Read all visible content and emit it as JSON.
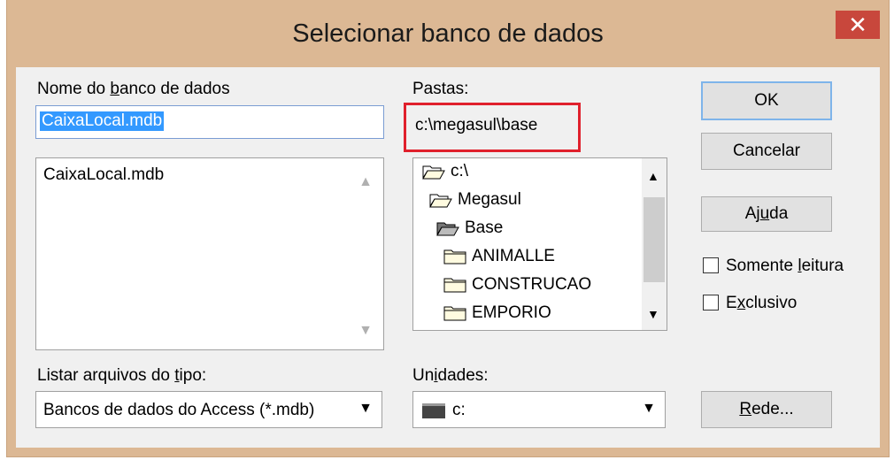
{
  "dialog": {
    "title": "Selecionar banco de dados",
    "close_symbol": "✕"
  },
  "database": {
    "label_pre": "Nome do ",
    "label_u": "b",
    "label_post": "anco de dados",
    "input_value": "CaixaLocal.mdb",
    "files": [
      "CaixaLocal.mdb"
    ]
  },
  "folders": {
    "label": "Pastas:",
    "current_path": "c:\\megasul\\base",
    "tree": [
      "c:\\",
      "Megasul",
      "Base",
      "ANIMALLE",
      "CONSTRUCAO",
      "EMPORIO"
    ]
  },
  "filetype": {
    "label_pre": "Listar arquivos do ",
    "label_u": "t",
    "label_post": "ipo:",
    "selected": "Bancos de dados do Access (*.mdb)"
  },
  "drives": {
    "label_pre": "Un",
    "label_u": "i",
    "label_post": "dades:",
    "selected": "c:"
  },
  "buttons": {
    "ok": "OK",
    "cancel": "Cancelar",
    "help_pre": "Aj",
    "help_u": "u",
    "help_post": "da",
    "network_u": "R",
    "network_post": "ede..."
  },
  "options": {
    "readonly_pre": "Somente ",
    "readonly_u": "l",
    "readonly_post": "eitura",
    "exclusive_pre": "E",
    "exclusive_u": "x",
    "exclusive_post": "clusivo"
  },
  "colors": {
    "titlebar": "#dcb894",
    "close": "#c8473c",
    "highlight": "#e0202c",
    "selection": "#3399ff"
  }
}
